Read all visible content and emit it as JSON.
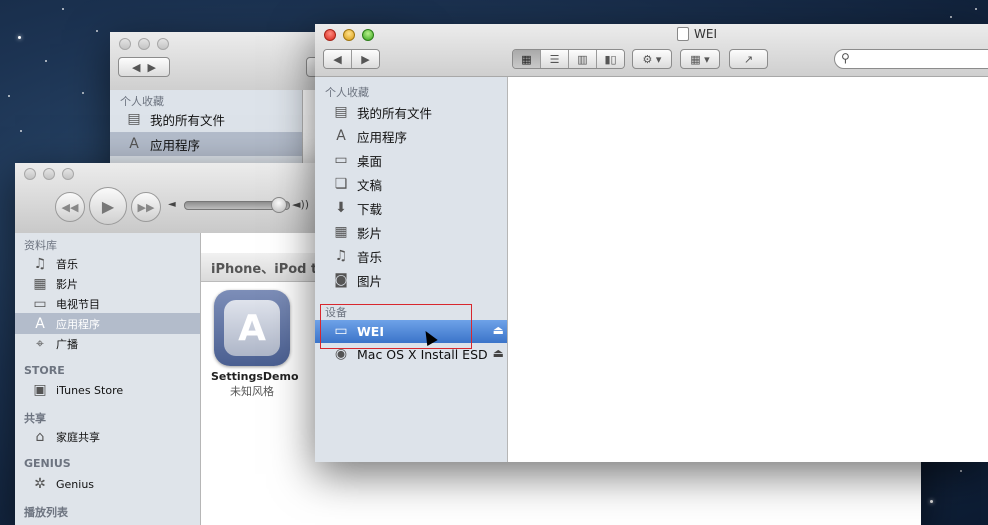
{
  "finder_back": {
    "sidebar_heading": "个人收藏",
    "items": [
      {
        "label": "我的所有文件"
      },
      {
        "label": "应用程序"
      }
    ]
  },
  "itunes": {
    "library_heading": "资料库",
    "library_items": [
      {
        "label": "音乐"
      },
      {
        "label": "影片"
      },
      {
        "label": "电视节目"
      },
      {
        "label": "应用程序"
      },
      {
        "label": "广播"
      }
    ],
    "store_heading": "STORE",
    "store_item": "iTunes Store",
    "shared_heading": "共享",
    "shared_item": "家庭共享",
    "genius_heading": "GENIUS",
    "genius_item": "Genius",
    "playlist_heading": "播放列表",
    "header_text": "iPhone、iPod t",
    "app_name": "SettingsDemo",
    "app_genre": "未知风格",
    "volume_level": 0.95
  },
  "finder": {
    "title": "WEI",
    "favorites_heading": "个人收藏",
    "favorites": [
      {
        "label": "我的所有文件",
        "icon": "all-files-icon"
      },
      {
        "label": "应用程序",
        "icon": "applications-icon"
      },
      {
        "label": "桌面",
        "icon": "desktop-icon"
      },
      {
        "label": "文稿",
        "icon": "documents-icon"
      },
      {
        "label": "下载",
        "icon": "downloads-icon"
      },
      {
        "label": "影片",
        "icon": "movies-icon"
      },
      {
        "label": "音乐",
        "icon": "music-icon"
      },
      {
        "label": "图片",
        "icon": "pictures-icon"
      }
    ],
    "devices_heading": "设备",
    "devices": [
      {
        "label": "WEI",
        "selected": true
      },
      {
        "label": "Mac OS X Install ESD",
        "selected": false
      }
    ],
    "search_placeholder": ""
  },
  "colors": {
    "selection": "#4a86d8",
    "annotation_box": "#d8272e"
  }
}
